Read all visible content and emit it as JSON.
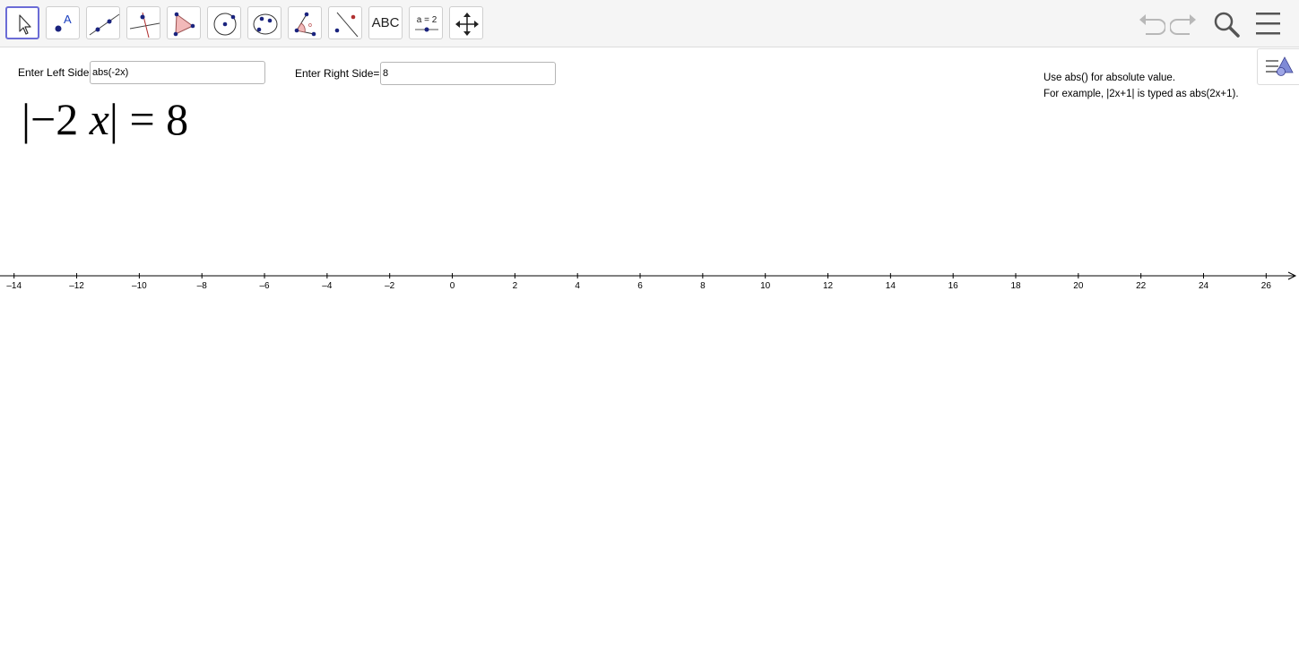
{
  "toolbar": {
    "tools": [
      {
        "name": "move-tool",
        "icon": "cursor-arrow-icon",
        "selected": true
      },
      {
        "name": "point-tool",
        "icon": "point-icon"
      },
      {
        "name": "line-tool",
        "icon": "line-through-points-icon"
      },
      {
        "name": "perpendicular-tool",
        "icon": "perpendicular-line-icon"
      },
      {
        "name": "polygon-tool",
        "icon": "polygon-icon"
      },
      {
        "name": "circle-tool",
        "icon": "circle-center-point-icon"
      },
      {
        "name": "conic-tool",
        "icon": "ellipse-icon"
      },
      {
        "name": "angle-tool",
        "icon": "angle-icon"
      },
      {
        "name": "reflect-tool",
        "icon": "reflect-about-line-icon"
      },
      {
        "name": "text-tool",
        "icon": "text-icon",
        "label": "ABC"
      },
      {
        "name": "slider-tool",
        "icon": "slider-icon",
        "label": "a = 2"
      },
      {
        "name": "move-graphics-tool",
        "icon": "move-graphics-icon"
      }
    ],
    "right": [
      "undo-icon",
      "redo-icon",
      "search-icon",
      "menu-icon"
    ],
    "accent_color": "#6b6cd6"
  },
  "left_side": {
    "label": "Enter Left Side",
    "value": "abs(-2x)"
  },
  "right_side": {
    "label": "Enter Right Side=",
    "value": "8"
  },
  "note": {
    "line1": "Use abs() for absolute value.",
    "line2": "For example, |2x+1| is typed as abs(2x+1)."
  },
  "equation": {
    "open_bar": "|",
    "minus": "−",
    "coefficient": "2",
    "variable": "x",
    "close_bar": "|",
    "equals": "=",
    "rhs": "8"
  },
  "axis": {
    "tick_labels": [
      "–14",
      "–12",
      "–10",
      "–8",
      "–6",
      "–4",
      "–2",
      "0",
      "2",
      "4",
      "6",
      "8",
      "10",
      "12",
      "14",
      "16",
      "18",
      "20",
      "22",
      "24",
      "26"
    ],
    "min": -14.45,
    "max": 27.05
  }
}
